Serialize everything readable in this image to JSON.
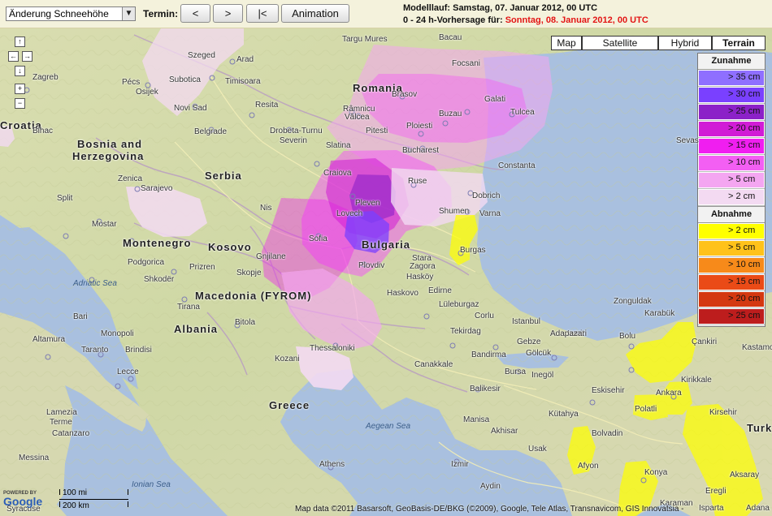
{
  "toolbar": {
    "parameter_select": "Änderung Schneehöhe",
    "select_arrow": "▼",
    "termin_label": "Termin:",
    "buttons": [
      {
        "name": "prev-button",
        "label": "<"
      },
      {
        "name": "next-button",
        "label": ">"
      },
      {
        "name": "first-button",
        "label": "|<"
      },
      {
        "name": "animation-button",
        "label": "Animation"
      }
    ],
    "model_run": "Modelllauf: Samstag, 07. Januar 2012, 00 UTC",
    "forecast_prefix": "0 - 24 h-Vorhersage für: ",
    "forecast_date": "Sonntag, 08. Januar 2012, 00 UTC"
  },
  "map_types": [
    {
      "label": "Map",
      "active": false
    },
    {
      "label": "Satellite",
      "active": false
    },
    {
      "label": "Hybrid",
      "active": false
    },
    {
      "label": "Terrain",
      "active": true
    }
  ],
  "nav_controls": [
    {
      "name": "pan-up-icon",
      "glyph": "↑"
    },
    {
      "name": "pan-left-icon",
      "glyph": "←"
    },
    {
      "name": "pan-right-icon",
      "glyph": "→"
    },
    {
      "name": "pan-down-icon",
      "glyph": "↓"
    },
    {
      "name": "zoom-in-icon",
      "glyph": "+"
    },
    {
      "name": "zoom-out-icon",
      "glyph": "−"
    }
  ],
  "legend": {
    "increase_title": "Zunahme",
    "decrease_title": "Abnahme",
    "increase": [
      {
        "label": "> 35 cm",
        "color": "#8f6fff"
      },
      {
        "label": "> 30 cm",
        "color": "#7a40ff"
      },
      {
        "label": "> 25 cm",
        "color": "#8c21c8"
      },
      {
        "label": "> 20 cm",
        "color": "#d11cd6"
      },
      {
        "label": "> 15 cm",
        "color": "#f01ef0"
      },
      {
        "label": "> 10 cm",
        "color": "#f35ff3"
      },
      {
        "label": "> 5 cm",
        "color": "#f4a6f1"
      },
      {
        "label": "> 2 cm",
        "color": "#f3daf2"
      }
    ],
    "decrease": [
      {
        "label": "> 2 cm",
        "color": "#ffff00"
      },
      {
        "label": "> 5 cm",
        "color": "#ffc21a"
      },
      {
        "label": "> 10 cm",
        "color": "#f78a1a"
      },
      {
        "label": "> 15 cm",
        "color": "#ea4b17"
      },
      {
        "label": "> 20 cm",
        "color": "#d43810"
      },
      {
        "label": "> 25 cm",
        "color": "#bd1d1d"
      }
    ]
  },
  "places": [
    {
      "name": "Szeged"
    },
    {
      "name": "Arad"
    },
    {
      "name": "Subotica"
    },
    {
      "name": "Timisoara"
    },
    {
      "name": "Zagreb"
    },
    {
      "name": "Pécs"
    },
    {
      "name": "Osijek"
    },
    {
      "name": "Novi Sad"
    },
    {
      "name": "Resita"
    },
    {
      "name": "Belgrade"
    },
    {
      "name": "Drobeta-Turnu"
    },
    {
      "name": "Severin"
    },
    {
      "name": "Bihac"
    },
    {
      "name": "Zenica"
    },
    {
      "name": "Sarajevo"
    },
    {
      "name": "Split"
    },
    {
      "name": "Mostar"
    },
    {
      "name": "Nis"
    },
    {
      "name": "Podgorica"
    },
    {
      "name": "Prizren"
    },
    {
      "name": "Shkodër"
    },
    {
      "name": "Skopje"
    },
    {
      "name": "Tirana"
    },
    {
      "name": "Bitola"
    },
    {
      "name": "Bari"
    },
    {
      "name": "Altamura"
    },
    {
      "name": "Monopoli"
    },
    {
      "name": "Taranto"
    },
    {
      "name": "Brindisi"
    },
    {
      "name": "Lecce"
    },
    {
      "name": "Lamezia"
    },
    {
      "name": "Terme"
    },
    {
      "name": "Catanzaro"
    },
    {
      "name": "Messina"
    },
    {
      "name": "Syracuse"
    },
    {
      "name": "Targu Mures"
    },
    {
      "name": "Bacau"
    },
    {
      "name": "Brasov"
    },
    {
      "name": "Focsani"
    },
    {
      "name": "Galati"
    },
    {
      "name": "Tulcea"
    },
    {
      "name": "Râmnicu"
    },
    {
      "name": "Vâlcea"
    },
    {
      "name": "Pitesti"
    },
    {
      "name": "Ploiesti"
    },
    {
      "name": "Buzau"
    },
    {
      "name": "Bucharest"
    },
    {
      "name": "Craiova"
    },
    {
      "name": "Constanta"
    },
    {
      "name": "Pleven"
    },
    {
      "name": "Ruse"
    },
    {
      "name": "Dobrich"
    },
    {
      "name": "Shumen"
    },
    {
      "name": "Varna"
    },
    {
      "name": "Sofia"
    },
    {
      "name": "Burgas"
    },
    {
      "name": "Stara"
    },
    {
      "name": "Zagora"
    },
    {
      "name": "Plovdiv"
    },
    {
      "name": "Haskovo"
    },
    {
      "name": "Edirne"
    },
    {
      "name": "Lüleburgaz"
    },
    {
      "name": "Corlu"
    },
    {
      "name": "Istanbul"
    },
    {
      "name": "Tekirdag"
    },
    {
      "name": "Izmit"
    },
    {
      "name": "Adapazari"
    },
    {
      "name": "Zonguldak"
    },
    {
      "name": "Karabük"
    },
    {
      "name": "Bolu"
    },
    {
      "name": "Gebze"
    },
    {
      "name": "Gölcük"
    },
    {
      "name": "Inegöl"
    },
    {
      "name": "Bursa"
    },
    {
      "name": "Bandirma"
    },
    {
      "name": "Canakkale"
    },
    {
      "name": "Balikesir"
    },
    {
      "name": "Eskisehir"
    },
    {
      "name": "Ankara"
    },
    {
      "name": "Polatli"
    },
    {
      "name": "Kirikkale"
    },
    {
      "name": "Kirsehir"
    },
    {
      "name": "Kütahya"
    },
    {
      "name": "Manisa"
    },
    {
      "name": "Akhisar"
    },
    {
      "name": "Izmir"
    },
    {
      "name": "Aydin"
    },
    {
      "name": "Afyon"
    },
    {
      "name": "Bolvadin"
    },
    {
      "name": "Konya"
    },
    {
      "name": "Karaman"
    },
    {
      "name": "Eregli"
    },
    {
      "name": "Aksaray"
    },
    {
      "name": "Çankiri"
    },
    {
      "name": "Usak"
    },
    {
      "name": "Athens"
    },
    {
      "name": "Thessaloniki"
    },
    {
      "name": "Sevas"
    },
    {
      "name": "Kastamonu"
    },
    {
      "name": "Isparta"
    },
    {
      "name": "Adana"
    },
    {
      "name": "Slatina"
    },
    {
      "name": "Gnjilane"
    },
    {
      "name": "Lovech"
    },
    {
      "name": "Kozani"
    },
    {
      "name": "Hasköy"
    }
  ],
  "countries": [
    {
      "name": "Romania"
    },
    {
      "name": "Bosnia and"
    },
    {
      "name": "Herzegovina"
    },
    {
      "name": "Serbia"
    },
    {
      "name": "Montenegro"
    },
    {
      "name": "Kosovo"
    },
    {
      "name": "Bulgaria"
    },
    {
      "name": "Macedonia (FYROM)"
    },
    {
      "name": "Albania"
    },
    {
      "name": "Greece"
    },
    {
      "name": "Croatia"
    },
    {
      "name": "Turk"
    }
  ],
  "seas": [
    {
      "name": "Adriatic Sea"
    },
    {
      "name": "Aegean Sea"
    },
    {
      "name": "Ionian Sea"
    }
  ],
  "scale": {
    "miles": "100 mi",
    "km": "200 km"
  },
  "google_logo": {
    "powered": "POWERED BY",
    "name": "Google"
  },
  "copyright": "Map data ©2011 Basarsoft, GeoBasis-DE/BKG (©2009), Google, Tele Atlas, Transnavicom, GIS Innovatsia -"
}
